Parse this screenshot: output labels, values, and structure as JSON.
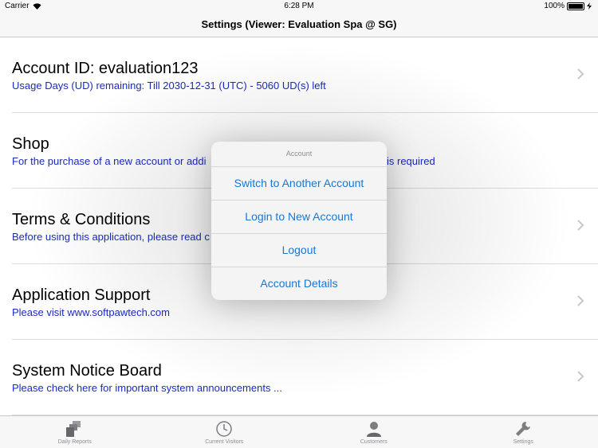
{
  "status_bar": {
    "carrier": "Carrier",
    "time": "6:28 PM",
    "battery": "100%"
  },
  "nav": {
    "title": "Settings (Viewer: Evaluation Spa @ SG)"
  },
  "rows": [
    {
      "title": "Account ID: evaluation123",
      "subtitle": "Usage Days (UD) remaining: Till 2030-12-31 (UTC) - 5060 UD(s) left"
    },
    {
      "title": "Shop",
      "subtitle": "For the purchase of a new account or addi",
      "subtitle_tail": "is required"
    },
    {
      "title": "Terms & Conditions",
      "subtitle": "Before using this application, please read c"
    },
    {
      "title": "Application Support",
      "subtitle": "Please visit www.softpawtech.com"
    },
    {
      "title": "System Notice Board",
      "subtitle": "Please check here for important system announcements ..."
    }
  ],
  "popover": {
    "header": "Account",
    "actions": [
      "Switch to Another Account",
      "Login to New Account",
      "Logout",
      "Account Details"
    ]
  },
  "tabs": [
    {
      "label": "Daily Reports",
      "icon": "daily-reports-icon"
    },
    {
      "label": "Current Visitors",
      "icon": "clock-icon"
    },
    {
      "label": "Customers",
      "icon": "person-icon"
    },
    {
      "label": "Settings",
      "icon": "wrench-icon"
    }
  ],
  "colors": {
    "accent": "#1877d6",
    "subtitle": "#1a2bbf",
    "tab_label": "#8e8e93"
  }
}
